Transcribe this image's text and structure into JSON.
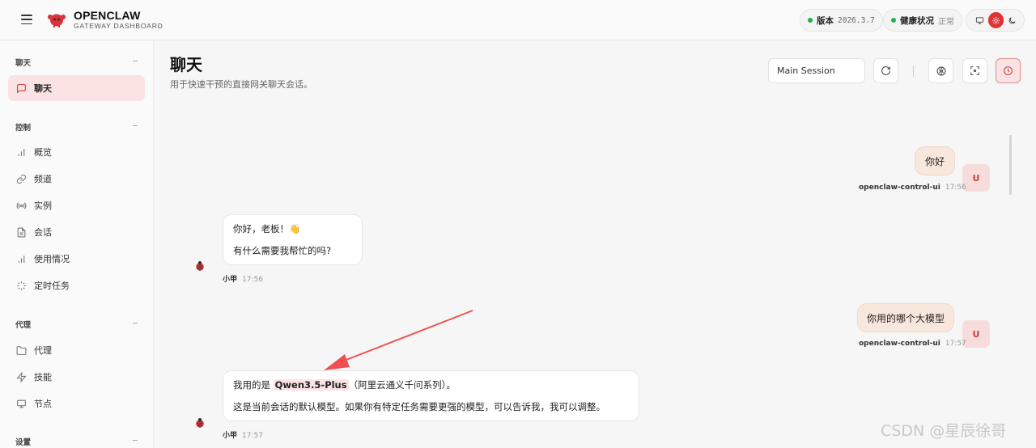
{
  "header": {
    "brand_title": "OPENCLAW",
    "brand_subtitle": "GATEWAY DASHBOARD",
    "version_label": "版本",
    "version_value": "2026.3.7",
    "health_label": "健康状况",
    "health_value": "正常",
    "status_color": "#22b14c",
    "accent_color": "#e03232"
  },
  "sidebar": {
    "sections": [
      {
        "label": "聊天",
        "items": [
          {
            "label": "聊天",
            "icon": "message-square-icon",
            "active": true
          }
        ]
      },
      {
        "label": "控制",
        "items": [
          {
            "label": "概览",
            "icon": "bar-chart-icon"
          },
          {
            "label": "频道",
            "icon": "link-icon"
          },
          {
            "label": "实例",
            "icon": "radio-icon"
          },
          {
            "label": "会话",
            "icon": "file-text-icon"
          },
          {
            "label": "使用情况",
            "icon": "bar-chart-icon"
          },
          {
            "label": "定时任务",
            "icon": "loader-icon"
          }
        ]
      },
      {
        "label": "代理",
        "items": [
          {
            "label": "代理",
            "icon": "folder-icon"
          },
          {
            "label": "技能",
            "icon": "zap-icon"
          },
          {
            "label": "节点",
            "icon": "monitor-icon"
          }
        ]
      },
      {
        "label": "设置",
        "items": []
      }
    ]
  },
  "main": {
    "title": "聊天",
    "subtitle": "用于快速干预的直接网关聊天会话。",
    "session_value": "Main Session"
  },
  "messages": [
    {
      "role": "user",
      "text": "你好",
      "author": "openclaw-control-ui",
      "time": "17:56",
      "avatar": "U"
    },
    {
      "role": "assistant",
      "lines": [
        "你好，老板！👋",
        "有什么需要我帮忙的吗?"
      ],
      "author": "小甲",
      "time": "17:56"
    },
    {
      "role": "user",
      "text": "你用的哪个大模型",
      "author": "openclaw-control-ui",
      "time": "17:57",
      "avatar": "U"
    },
    {
      "role": "assistant",
      "line1_prefix": "我用的是 ",
      "line1_highlight": "Qwen3.5-Plus",
      "line1_suffix": "（阿里云通义千问系列）。",
      "line2": "这是当前会话的默认模型。如果你有特定任务需要更强的模型，可以告诉我，我可以调整。",
      "author": "小甲",
      "time": "17:57"
    }
  ],
  "watermark": "CSDN @星辰徐哥"
}
